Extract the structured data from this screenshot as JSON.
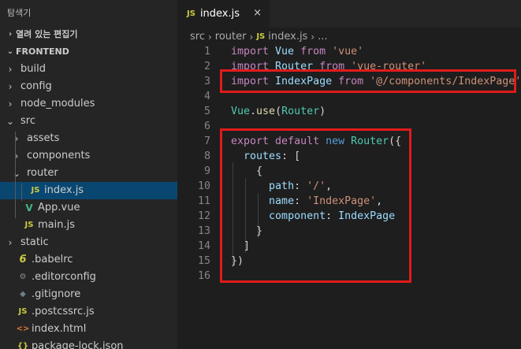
{
  "sidebar": {
    "title": "탐색기",
    "open_editors": "열려 있는 편집기",
    "project": "FRONTEND",
    "items": [
      {
        "label": "build",
        "kind": "folder",
        "depth": 0,
        "expanded": false
      },
      {
        "label": "config",
        "kind": "folder",
        "depth": 0,
        "expanded": false
      },
      {
        "label": "node_modules",
        "kind": "folder",
        "depth": 0,
        "expanded": false
      },
      {
        "label": "src",
        "kind": "folder",
        "depth": 0,
        "expanded": true
      },
      {
        "label": "assets",
        "kind": "folder",
        "depth": 1,
        "expanded": false
      },
      {
        "label": "components",
        "kind": "folder",
        "depth": 1,
        "expanded": false
      },
      {
        "label": "router",
        "kind": "folder",
        "depth": 1,
        "expanded": true
      },
      {
        "label": "index.js",
        "kind": "js",
        "depth": 2,
        "selected": true
      },
      {
        "label": "App.vue",
        "kind": "vue",
        "depth": 1
      },
      {
        "label": "main.js",
        "kind": "js",
        "depth": 1
      },
      {
        "label": "static",
        "kind": "folder",
        "depth": 0,
        "expanded": false
      },
      {
        "label": ".babelrc",
        "kind": "babel",
        "depth": 0
      },
      {
        "label": ".editorconfig",
        "kind": "gear",
        "depth": 0
      },
      {
        "label": ".gitignore",
        "kind": "git",
        "depth": 0
      },
      {
        "label": ".postcssrc.js",
        "kind": "js",
        "depth": 0
      },
      {
        "label": "index.html",
        "kind": "html",
        "depth": 0
      },
      {
        "label": "package-lock.json",
        "kind": "json",
        "depth": 0
      }
    ]
  },
  "tab": {
    "js_badge": "JS",
    "name": "index.js",
    "close": "×"
  },
  "breadcrumb": {
    "part1": "src",
    "part2": "router",
    "js_badge": "JS",
    "part3": "index.js",
    "more": "..."
  },
  "icons": {
    "chevron_right": "›",
    "chevron_down": "⌄",
    "js": "JS",
    "vue": "V",
    "babel": "6",
    "gear": "⚙",
    "git": "◆",
    "html": "<>",
    "json": "{}"
  },
  "colors": {
    "highlight": "#e01b1b",
    "selection": "#094771",
    "js_icon": "#cbcb41",
    "vue_icon": "#41b883"
  },
  "code": [
    {
      "n": "1",
      "tokens": [
        [
          "k",
          "import "
        ],
        [
          "v",
          "Vue "
        ],
        [
          "k",
          "from "
        ],
        [
          "s",
          "'vue'"
        ]
      ]
    },
    {
      "n": "2",
      "tokens": [
        [
          "k",
          "import "
        ],
        [
          "v",
          "Router "
        ],
        [
          "k",
          "from "
        ],
        [
          "s",
          "'vue-router'"
        ]
      ]
    },
    {
      "n": "3",
      "tokens": [
        [
          "k",
          "import "
        ],
        [
          "v",
          "IndexPage "
        ],
        [
          "k",
          "from "
        ],
        [
          "s",
          "'@/components/IndexPage'"
        ]
      ]
    },
    {
      "n": "4",
      "tokens": []
    },
    {
      "n": "5",
      "tokens": [
        [
          "t",
          "Vue"
        ],
        [
          "p",
          "."
        ],
        [
          "f",
          "use"
        ],
        [
          "p",
          "("
        ],
        [
          "t",
          "Router"
        ],
        [
          "p",
          ")"
        ]
      ]
    },
    {
      "n": "6",
      "tokens": []
    },
    {
      "n": "7",
      "tokens": [
        [
          "k",
          "export "
        ],
        [
          "k",
          "default "
        ],
        [
          "b",
          "new "
        ],
        [
          "t",
          "Router"
        ],
        [
          "p",
          "({"
        ]
      ]
    },
    {
      "n": "8",
      "tokens": [
        [
          "p",
          "  "
        ],
        [
          "v",
          "routes"
        ],
        [
          "p",
          ": ["
        ]
      ]
    },
    {
      "n": "9",
      "tokens": [
        [
          "p",
          "    {"
        ]
      ]
    },
    {
      "n": "10",
      "tokens": [
        [
          "p",
          "      "
        ],
        [
          "v",
          "path"
        ],
        [
          "p",
          ": "
        ],
        [
          "s",
          "'/'"
        ],
        [
          "p",
          ","
        ]
      ]
    },
    {
      "n": "11",
      "tokens": [
        [
          "p",
          "      "
        ],
        [
          "v",
          "name"
        ],
        [
          "p",
          ": "
        ],
        [
          "s",
          "'IndexPage'"
        ],
        [
          "p",
          ","
        ]
      ]
    },
    {
      "n": "12",
      "tokens": [
        [
          "p",
          "      "
        ],
        [
          "v",
          "component"
        ],
        [
          "p",
          ": "
        ],
        [
          "v",
          "IndexPage"
        ]
      ]
    },
    {
      "n": "13",
      "tokens": [
        [
          "p",
          "    }"
        ]
      ]
    },
    {
      "n": "14",
      "tokens": [
        [
          "p",
          "  ]"
        ]
      ]
    },
    {
      "n": "15",
      "tokens": [
        [
          "p",
          "})"
        ]
      ]
    },
    {
      "n": "16",
      "tokens": []
    }
  ]
}
